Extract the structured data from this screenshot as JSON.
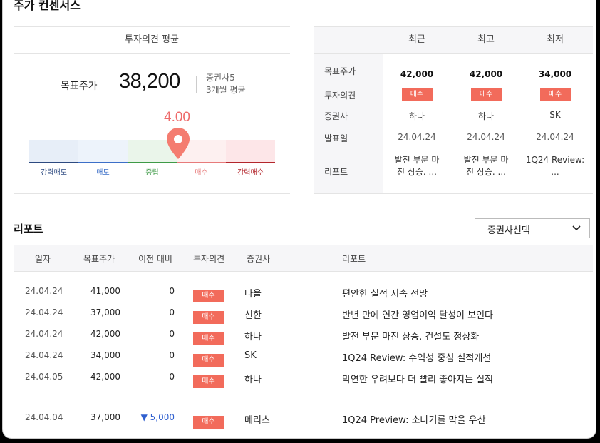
{
  "page_title": "주가 컨센서스",
  "avg": {
    "header": "투자의견 평균",
    "target_label": "목표주가",
    "target_value": "38,200",
    "brokers": "증권사5",
    "period": "3개월 평균",
    "score": "4.00",
    "score_value": 4.0,
    "scale_labels": [
      "강력매도",
      "매도",
      "중립",
      "매수",
      "강력매수"
    ]
  },
  "recent": {
    "columns": [
      "최근",
      "최고",
      "최저"
    ],
    "row_labels": [
      "목표주가",
      "투자의견",
      "증권사",
      "발표일",
      "리포트"
    ],
    "cols": [
      {
        "price": "42,000",
        "opinion": "매수",
        "broker": "하나",
        "date": "24.04.24",
        "report_l1": "발전 부문 마",
        "report_l2": "진 상승. ..."
      },
      {
        "price": "42,000",
        "opinion": "매수",
        "broker": "하나",
        "date": "24.04.24",
        "report_l1": "발전 부문 마",
        "report_l2": "진 상승. ..."
      },
      {
        "price": "34,000",
        "opinion": "매수",
        "broker": "SK",
        "date": "24.04.24",
        "report_l1": "1Q24 Review:",
        "report_l2": "..."
      }
    ]
  },
  "reports": {
    "title": "리포트",
    "select_label": "증권사선택",
    "headers": [
      "일자",
      "목표주가",
      "이전 대비",
      "투자의견",
      "증권사",
      "리포트"
    ],
    "rows": [
      {
        "date": "24.04.24",
        "price": "41,000",
        "change": "0",
        "opinion": "매수",
        "broker": "다올",
        "title": "편안한 실적 지속 전망"
      },
      {
        "date": "24.04.24",
        "price": "37,000",
        "change": "0",
        "opinion": "매수",
        "broker": "신한",
        "title": "반년 만에 연간 영업이익 달성이 보인다"
      },
      {
        "date": "24.04.24",
        "price": "42,000",
        "change": "0",
        "opinion": "매수",
        "broker": "하나",
        "title": "발전 부문 마진 상승. 건설도 정상화"
      },
      {
        "date": "24.04.24",
        "price": "34,000",
        "change": "0",
        "opinion": "매수",
        "broker": "SK",
        "title": "1Q24 Review: 수익성 중심 실적개선"
      },
      {
        "date": "24.04.05",
        "price": "42,000",
        "change": "0",
        "opinion": "매수",
        "broker": "하나",
        "title": "막연한 우려보다 더 빨리 좋아지는 실적"
      },
      {
        "date": "24.04.04",
        "price": "37,000",
        "change": "▼ 5,000",
        "opinion": "매수",
        "broker": "메리츠",
        "title": "1Q24 Preview: 소나기를 막을 우산"
      }
    ]
  },
  "colors": {
    "accent": "#f26b5b",
    "score": "#ee6b6b",
    "down": "#2f5fcf"
  }
}
